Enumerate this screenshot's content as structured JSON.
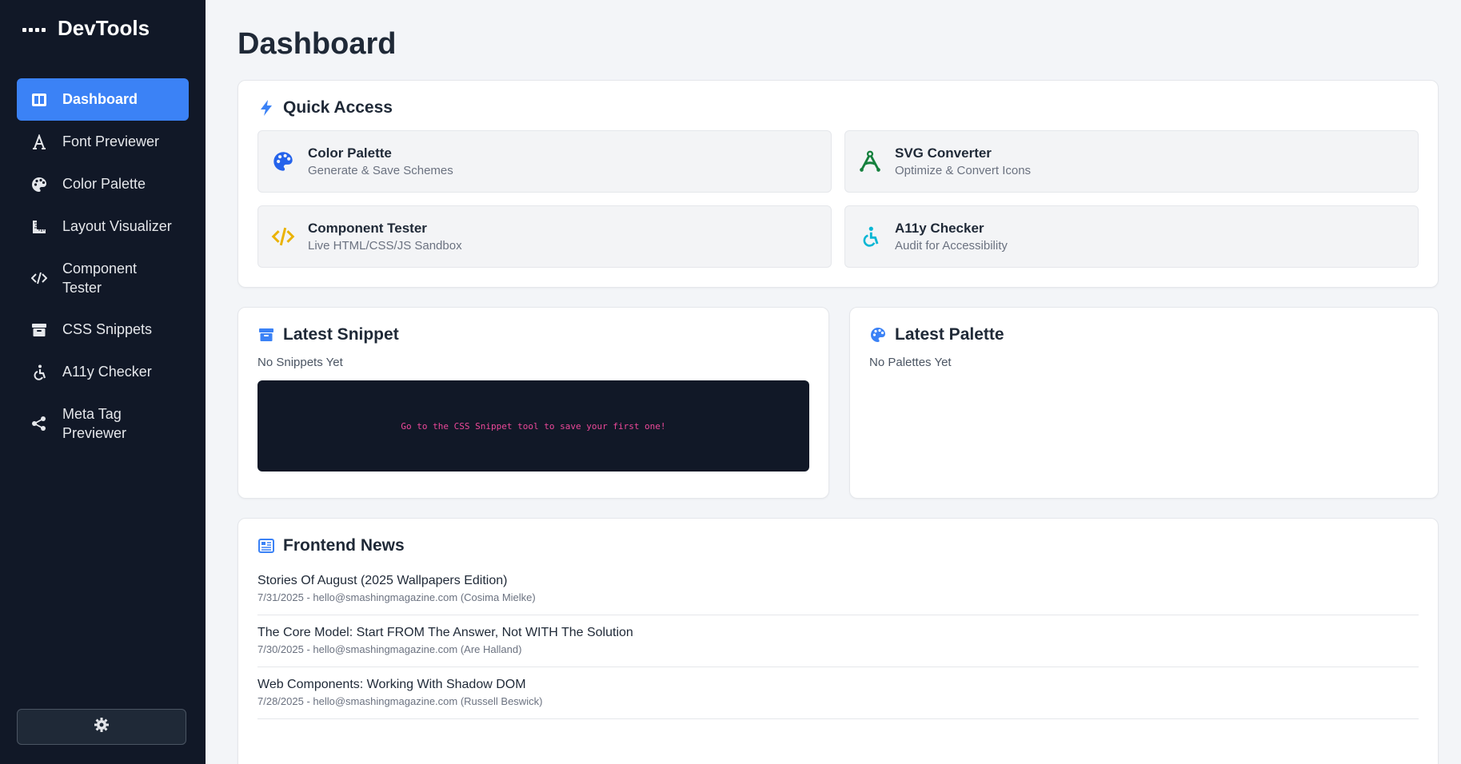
{
  "app": {
    "title": "DevTools"
  },
  "sidebar": {
    "items": [
      {
        "label": "Dashboard",
        "icon": "dashboard-icon"
      },
      {
        "label": "Font Previewer",
        "icon": "font-icon"
      },
      {
        "label": "Color Palette",
        "icon": "palette-icon"
      },
      {
        "label": "Layout Visualizer",
        "icon": "ruler-icon"
      },
      {
        "label": "Component Tester",
        "icon": "code-icon"
      },
      {
        "label": "CSS Snippets",
        "icon": "archive-icon"
      },
      {
        "label": "A11y Checker",
        "icon": "accessibility-icon"
      },
      {
        "label": "Meta Tag Previewer",
        "icon": "share-icon"
      }
    ],
    "settings_icon": "gear-icon"
  },
  "main": {
    "title": "Dashboard",
    "quick_access": {
      "heading": "Quick Access",
      "items": [
        {
          "title": "Color Palette",
          "subtitle": "Generate & Save Schemes",
          "icon": "palette-icon",
          "color": "#2563eb"
        },
        {
          "title": "SVG Converter",
          "subtitle": "Optimize & Convert Icons",
          "icon": "pen-tool-icon",
          "color": "#15803d"
        },
        {
          "title": "Component Tester",
          "subtitle": "Live HTML/CSS/JS Sandbox",
          "icon": "code-icon",
          "color": "#eab308"
        },
        {
          "title": "A11y Checker",
          "subtitle": "Audit for Accessibility",
          "icon": "accessibility-icon",
          "color": "#06b6d4"
        }
      ]
    },
    "latest_snippet": {
      "heading": "Latest Snippet",
      "empty_text": "No Snippets Yet",
      "code_placeholder": "Go to the CSS Snippet tool to save your first one!"
    },
    "latest_palette": {
      "heading": "Latest Palette",
      "empty_text": "No Palettes Yet"
    },
    "news": {
      "heading": "Frontend News",
      "items": [
        {
          "title": "Stories Of August (2025 Wallpapers Edition)",
          "meta": "7/31/2025 - hello@smashingmagazine.com (Cosima Mielke)"
        },
        {
          "title": "The Core Model: Start FROM The Answer, Not WITH The Solution",
          "meta": "7/30/2025 - hello@smashingmagazine.com (Are Halland)"
        },
        {
          "title": "Web Components: Working With Shadow DOM",
          "meta": "7/28/2025 - hello@smashingmagazine.com (Russell Beswick)"
        }
      ]
    }
  },
  "colors": {
    "accent": "#3b82f6",
    "sidebar_bg": "#111827",
    "page_bg": "#f3f5f8"
  }
}
